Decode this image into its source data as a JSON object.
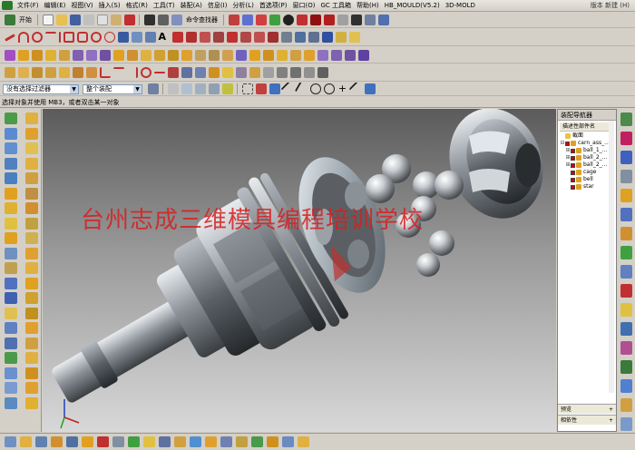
{
  "menubar": {
    "items": [
      "文件(F)",
      "编辑(E)",
      "视图(V)",
      "插入(S)",
      "格式(R)",
      "工具(T)",
      "装配(A)",
      "信息(I)",
      "分析(L)",
      "首选项(P)",
      "窗口(O)",
      "GC 工具箱",
      "帮助(H)",
      "HB_MOULD(V5.2)",
      "3D-MOLD"
    ],
    "title": "版本  新建 (H)"
  },
  "toolbar1": {
    "start_label": "开始",
    "command_finder_label": "命令查找器"
  },
  "selection": {
    "filter_value": "没有选择过滤器",
    "scope_value": "整个装配"
  },
  "status": {
    "prompt": "选择对象并使用 MB3，或者双击某一对象"
  },
  "viewport": {
    "watermark": "台州志成三维模具编程培训学校"
  },
  "navigator": {
    "title": "装配导航器",
    "column_header": "描述性部件名",
    "rows": [
      {
        "expander": "",
        "label": "截面",
        "folder": true
      },
      {
        "expander": "⊟",
        "label": "carn_ass_…",
        "folder": false
      },
      {
        "expander": "⊞",
        "label": "ball_1_…",
        "folder": false
      },
      {
        "expander": "⊞",
        "label": "ball_2_…",
        "folder": false
      },
      {
        "expander": "⊞",
        "label": "ball_2_…",
        "folder": false
      },
      {
        "expander": "",
        "label": "cage",
        "folder": false
      },
      {
        "expander": "",
        "label": "bell",
        "folder": false
      },
      {
        "expander": "",
        "label": "star",
        "folder": false
      }
    ],
    "preview_label": "预览",
    "dependency_label": "相依性"
  },
  "colors": {
    "chrome": "#d4d0c8",
    "viewport_top": "#5b5b5b",
    "viewport_bottom": "#d8d8d8",
    "watermark": "#d71e1e",
    "part_metal": "#b8bec4"
  },
  "icons": {
    "toolbar": [
      "new-file-icon",
      "open-icon",
      "save-icon",
      "undo-icon",
      "redo-icon",
      "command-finder-icon",
      "sketch-icon",
      "line-icon",
      "arc-icon",
      "circle-icon",
      "extrude-icon",
      "revolve-icon",
      "hole-icon",
      "shell-icon",
      "blend-icon",
      "chamfer-icon",
      "fit-view-icon",
      "zoom-icon",
      "rotate-icon",
      "pan-icon",
      "shaded-icon",
      "wireframe-icon"
    ],
    "left": [
      "assembly-icon",
      "component-icon",
      "constraint-icon",
      "move-icon",
      "mirror-icon",
      "array-icon",
      "explode-icon",
      "section-icon"
    ],
    "right": [
      "assembly-navigator-icon",
      "part-navigator-icon",
      "history-icon",
      "roles-icon",
      "palette-icon",
      "web-browser-icon",
      "system-materials-icon"
    ]
  }
}
